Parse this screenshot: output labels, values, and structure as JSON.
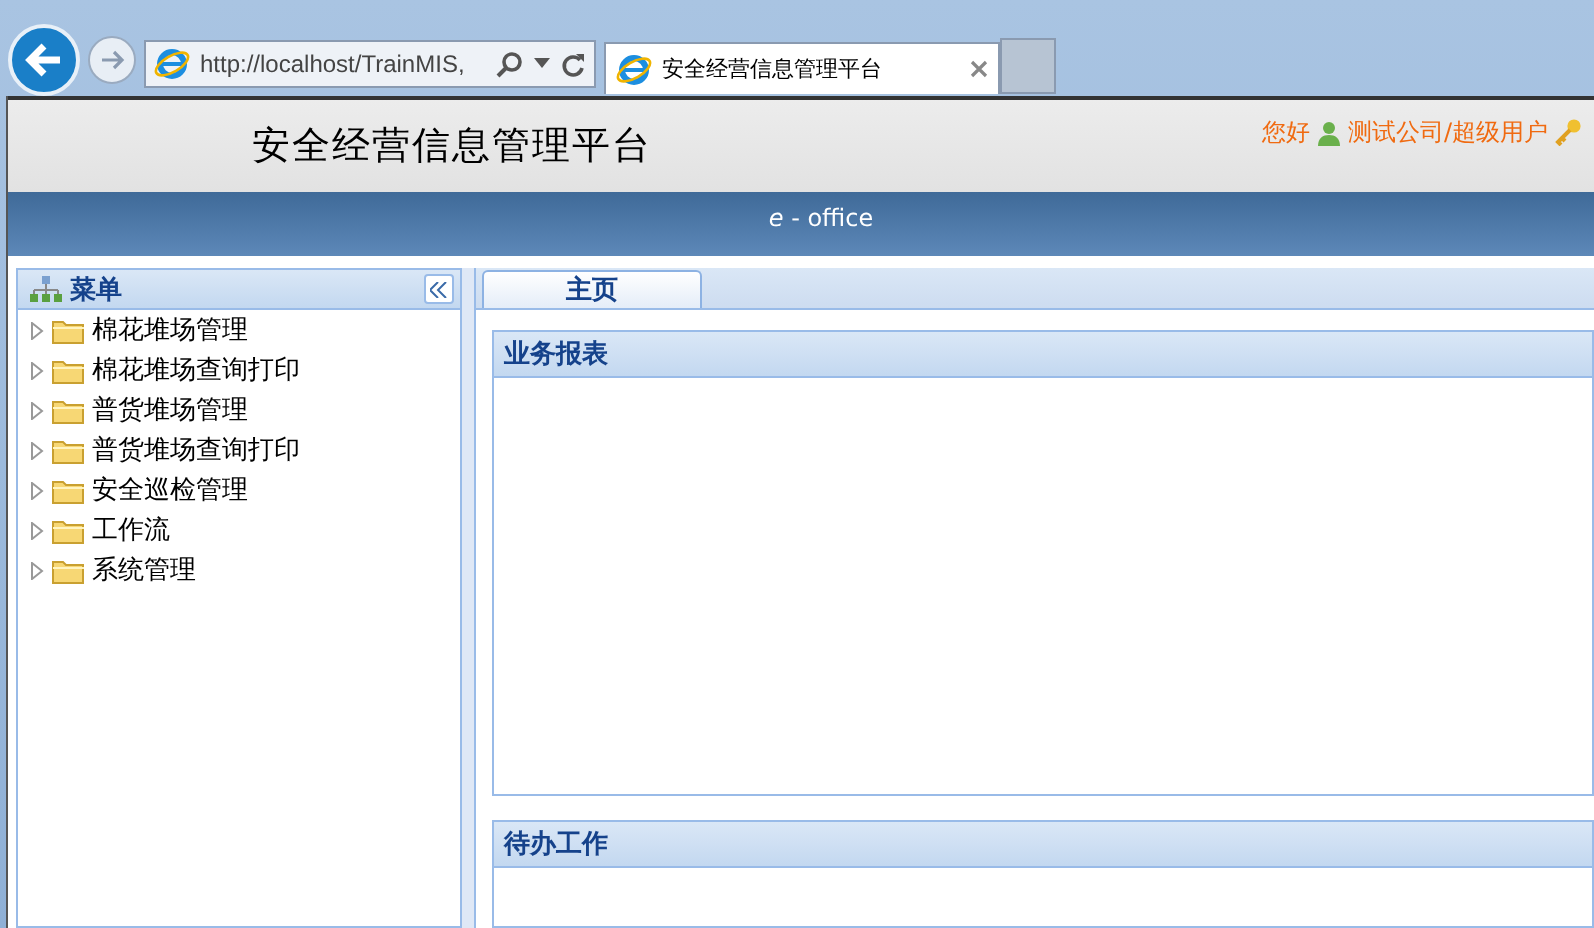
{
  "browser": {
    "address": "http://localhost/TrainMIS,",
    "tab_title": "安全经营信息管理平台"
  },
  "header": {
    "title": "安全经营信息管理平台",
    "greeting": "您好",
    "user": "测试公司/超级用户",
    "subtitle": "*e* - office"
  },
  "sidebar": {
    "title": "菜单",
    "items": [
      {
        "label": "棉花堆场管理",
        "expanded": false
      },
      {
        "label": "棉花堆场查询打印",
        "expanded": false
      },
      {
        "label": "普货堆场管理",
        "expanded": false
      },
      {
        "label": "普货堆场查询打印",
        "expanded": false
      },
      {
        "label": "安全巡检管理",
        "expanded": false
      },
      {
        "label": "工作流",
        "expanded": false
      },
      {
        "label": "系统管理",
        "expanded": false
      }
    ]
  },
  "tabs": [
    {
      "label": "主页",
      "selected": true
    }
  ],
  "panels": [
    {
      "title": "业务报表"
    },
    {
      "title": "待办工作"
    }
  ]
}
